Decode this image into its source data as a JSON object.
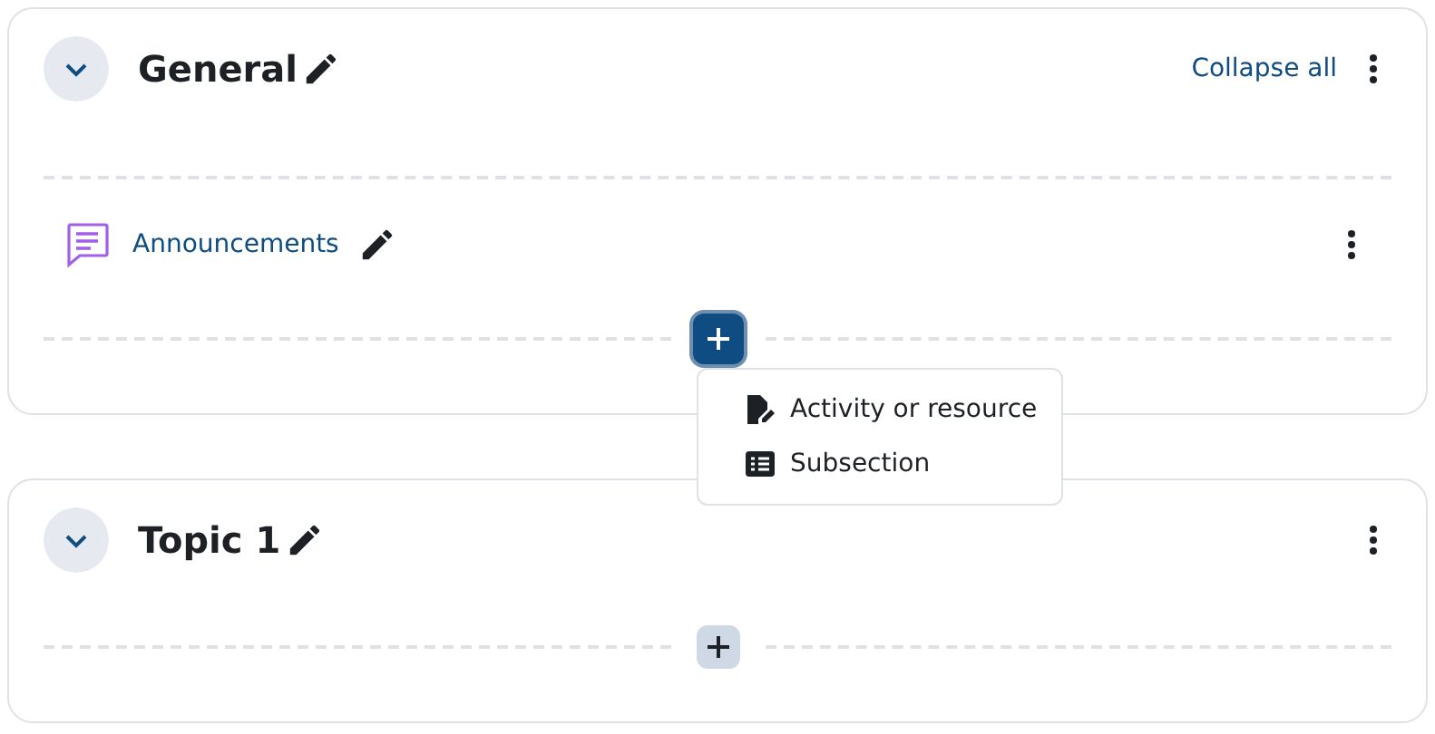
{
  "sections": [
    {
      "title": "General",
      "expanded": true,
      "collapse_all": "Collapse all",
      "activities": [
        {
          "name": "Announcements",
          "kind": "forum"
        }
      ],
      "add_button": {
        "expanded": true
      },
      "add_menu": [
        {
          "label": "Activity or resource",
          "kind": "activity"
        },
        {
          "label": "Subsection",
          "kind": "subsection"
        }
      ]
    },
    {
      "title": "Topic 1",
      "expanded": true,
      "add_button": {
        "expanded": false
      }
    }
  ]
}
